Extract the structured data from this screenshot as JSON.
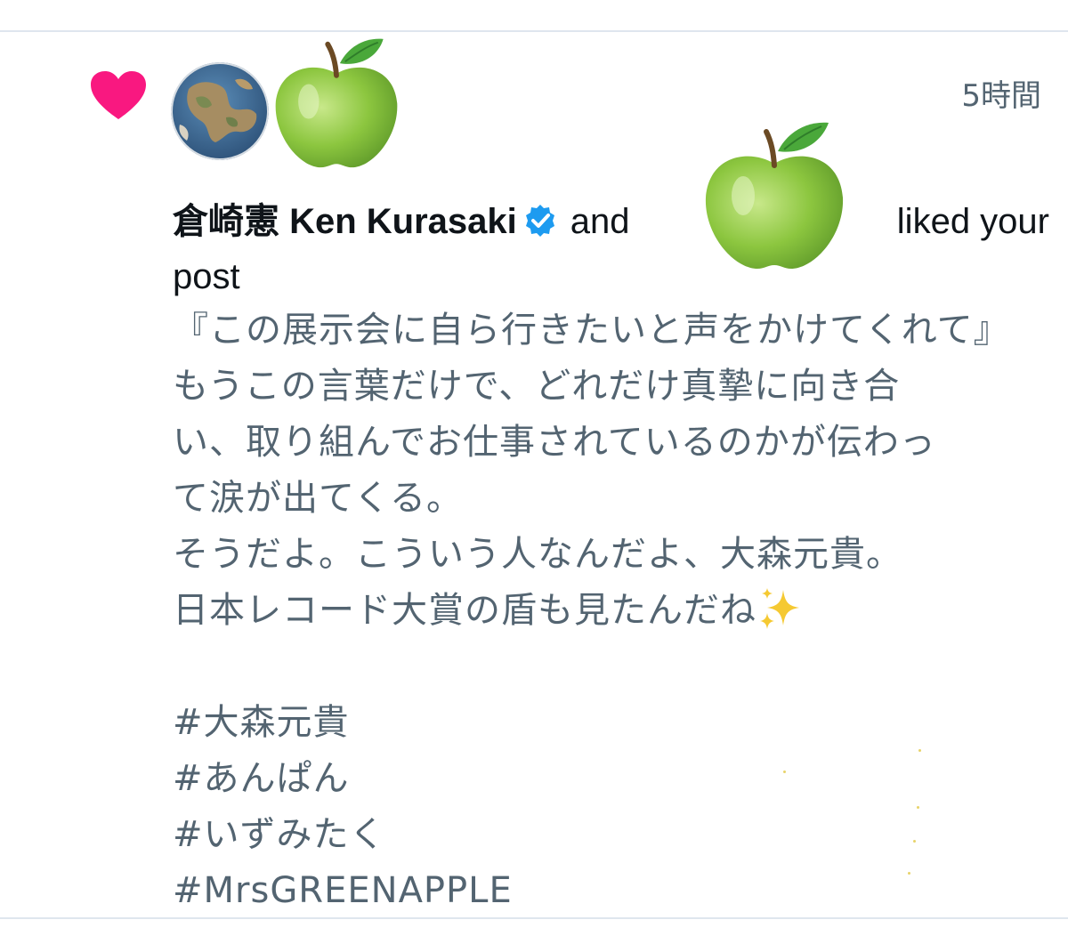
{
  "notification": {
    "time": "5時間",
    "actor_name": "倉崎憲 Ken Kurasaki",
    "conjunction": "and",
    "action": "liked your",
    "action_object": "post"
  },
  "post": {
    "lines": [
      "『この展示会に自ら行きたいと声をかけてくれて』",
      "もうこの言葉だけで、どれだけ真摯に向き合",
      "い、取り組んでお仕事されているのかが伝わっ",
      "て涙が出てくる。",
      "そうだよ。こういう人なんだよ、大森元貴。",
      "日本レコード大賞の盾も見たんだね"
    ],
    "hashtags": [
      "#大森元貴",
      "#あんぱん",
      "#いずみたく",
      "#MrsGREENAPPLE"
    ]
  },
  "icons": {
    "like": "heart-icon",
    "verified": "verified-badge-icon",
    "sparkles": "sparkles-emoji",
    "redaction": "green-apple-emoji"
  },
  "colors": {
    "heart": "#f91880",
    "verified": "#1d9bf0",
    "muted_text": "#536471",
    "divider": "#dfe6ee"
  }
}
